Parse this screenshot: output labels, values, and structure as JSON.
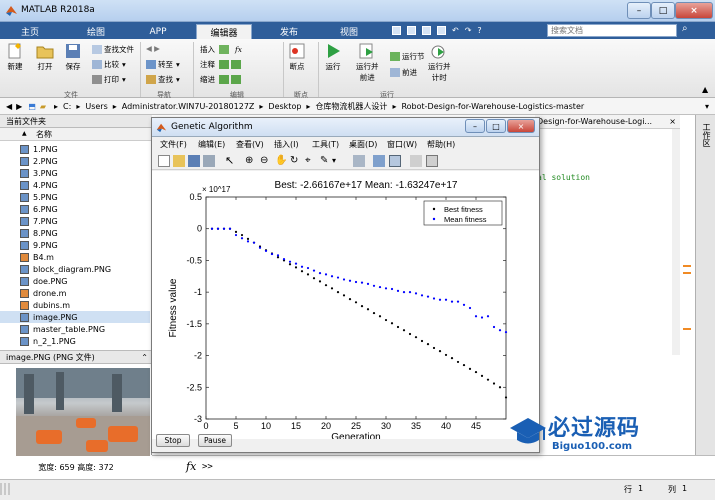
{
  "window": {
    "title": "MATLAB R2018a",
    "controls": [
      "–",
      "□",
      "×"
    ]
  },
  "tabs": [
    {
      "label": "主页"
    },
    {
      "label": "绘图"
    },
    {
      "label": "APP"
    },
    {
      "label": "编辑器",
      "active": true
    },
    {
      "label": "发布"
    },
    {
      "label": "视图"
    }
  ],
  "search": {
    "placeholder": "搜索文档"
  },
  "ribbon": {
    "buttons": {
      "new": "新建",
      "open": "打开",
      "save": "保存",
      "breakpoint": "断点",
      "run": "运行",
      "run_advance": "运行并\n前进",
      "advance": "前进",
      "run_time": "运行并\n计时"
    },
    "small": {
      "find_files": "查找文件",
      "compare": "比较",
      "print": "打印",
      "goto": "转至",
      "find": "查找",
      "insert": "插入",
      "comment": "注释",
      "indent": "缩进",
      "run_section": "运行节"
    },
    "groups": {
      "file": "文件",
      "nav": "导航",
      "edit": "编辑",
      "breakpoints": "断点",
      "run": "运行"
    }
  },
  "path": {
    "segments": [
      "C:",
      "Users",
      "Administrator.WIN7U-20180127Z",
      "Desktop",
      "仓库物流机器人设计",
      "Robot-Design-for-Warehouse-Logistics-master"
    ]
  },
  "current_folder": {
    "title": "当前文件夹",
    "column": "名称",
    "files": [
      {
        "name": "1.PNG",
        "type": "png"
      },
      {
        "name": "2.PNG",
        "type": "png"
      },
      {
        "name": "3.PNG",
        "type": "png"
      },
      {
        "name": "4.PNG",
        "type": "png"
      },
      {
        "name": "5.PNG",
        "type": "png"
      },
      {
        "name": "6.PNG",
        "type": "png"
      },
      {
        "name": "7.PNG",
        "type": "png"
      },
      {
        "name": "8.PNG",
        "type": "png"
      },
      {
        "name": "9.PNG",
        "type": "png"
      },
      {
        "name": "B4.m",
        "type": "m"
      },
      {
        "name": "block_diagram.PNG",
        "type": "png"
      },
      {
        "name": "doe.PNG",
        "type": "png"
      },
      {
        "name": "drone.m",
        "type": "m"
      },
      {
        "name": "dubins.m",
        "type": "m"
      },
      {
        "name": "image.PNG",
        "type": "png",
        "selected": true
      },
      {
        "name": "master_table.PNG",
        "type": "png"
      },
      {
        "name": "n_2_1.PNG",
        "type": "png"
      }
    ],
    "details": "image.PNG  (PNG 文件)",
    "dims": "宽度: 659  高度: 372"
  },
  "editor": {
    "tab_path": "Design-for-Warehouse-Logi...",
    "code_line": "al solution"
  },
  "command": {
    "fx": "fx",
    "prompt": ">>"
  },
  "status": {
    "row": "行",
    "row_num": "1",
    "col": "列",
    "col_num": "1"
  },
  "right_strip": {
    "label": "工作区"
  },
  "ga_window": {
    "title": "Genetic Algorithm",
    "menu": [
      "文件(F)",
      "编辑(E)",
      "查看(V)",
      "插入(I)",
      "工具(T)",
      "桌面(D)",
      "窗口(W)",
      "帮助(H)"
    ],
    "stop_label": "Stop",
    "pause_label": "Pause"
  },
  "watermark": {
    "main": "必过源码",
    "sub": "Biguo100.com"
  },
  "colors": {
    "best": "#000000",
    "mean": "#0000ff",
    "accent": "#2f5e9a"
  },
  "chart_data": {
    "type": "scatter",
    "title": "Best: -2.66167e+17 Mean: -1.63247e+17",
    "xlabel": "Generation",
    "ylabel": "Fitness value",
    "exponent_label": "× 10^17",
    "xlim": [
      0,
      50
    ],
    "ylim": [
      -3,
      0.5
    ],
    "xticks": [
      0,
      5,
      10,
      15,
      20,
      25,
      30,
      35,
      40,
      45
    ],
    "yticks": [
      0.5,
      0,
      -0.5,
      -1,
      -1.5,
      -2,
      -2.5,
      -3
    ],
    "legend": "top-right",
    "series": [
      {
        "name": "Best fitness",
        "x": [
          1,
          2,
          3,
          4,
          5,
          6,
          7,
          8,
          9,
          10,
          11,
          12,
          13,
          14,
          15,
          16,
          17,
          18,
          19,
          20,
          21,
          22,
          23,
          24,
          25,
          26,
          27,
          28,
          29,
          30,
          31,
          32,
          33,
          34,
          35,
          36,
          37,
          38,
          39,
          40,
          41,
          42,
          43,
          44,
          45,
          46,
          47,
          48,
          49,
          50
        ],
        "y": [
          0,
          0,
          0,
          0,
          -0.05,
          -0.1,
          -0.16,
          -0.22,
          -0.28,
          -0.34,
          -0.39,
          -0.45,
          -0.5,
          -0.56,
          -0.61,
          -0.67,
          -0.72,
          -0.78,
          -0.83,
          -0.89,
          -0.94,
          -1.0,
          -1.05,
          -1.11,
          -1.16,
          -1.22,
          -1.27,
          -1.33,
          -1.38,
          -1.44,
          -1.49,
          -1.55,
          -1.6,
          -1.66,
          -1.71,
          -1.77,
          -1.82,
          -1.88,
          -1.93,
          -1.99,
          -2.04,
          -2.1,
          -2.15,
          -2.21,
          -2.26,
          -2.32,
          -2.38,
          -2.44,
          -2.5,
          -2.66
        ]
      },
      {
        "name": "Mean fitness",
        "x": [
          1,
          2,
          3,
          4,
          5,
          6,
          7,
          8,
          9,
          10,
          11,
          12,
          13,
          14,
          15,
          16,
          17,
          18,
          19,
          20,
          21,
          22,
          23,
          24,
          25,
          26,
          27,
          28,
          29,
          30,
          31,
          32,
          33,
          34,
          35,
          36,
          37,
          38,
          39,
          40,
          41,
          42,
          43,
          44,
          45,
          46,
          47,
          48,
          49,
          50
        ],
        "y": [
          0,
          0,
          0,
          0,
          -0.1,
          -0.15,
          -0.2,
          -0.22,
          -0.3,
          -0.35,
          -0.4,
          -0.42,
          -0.48,
          -0.52,
          -0.55,
          -0.6,
          -0.62,
          -0.66,
          -0.7,
          -0.72,
          -0.75,
          -0.77,
          -0.8,
          -0.82,
          -0.84,
          -0.85,
          -0.87,
          -0.9,
          -0.92,
          -0.94,
          -0.95,
          -0.98,
          -1.0,
          -1.0,
          -1.02,
          -1.05,
          -1.07,
          -1.1,
          -1.12,
          -1.12,
          -1.15,
          -1.15,
          -1.2,
          -1.25,
          -1.38,
          -1.4,
          -1.38,
          -1.55,
          -1.6,
          -1.63
        ]
      }
    ]
  }
}
